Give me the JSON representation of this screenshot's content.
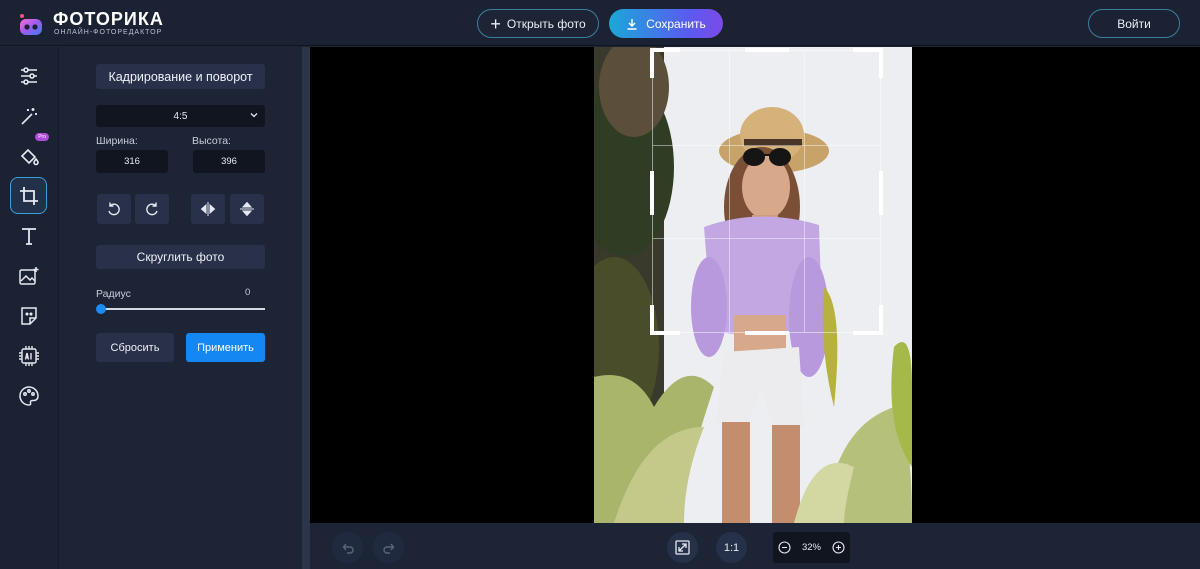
{
  "brand": {
    "title": "ФОТОРИКА",
    "subtitle": "ОНЛАЙН-ФОТОРЕДАКТОР",
    "accent_color": "#7c4ae8"
  },
  "header": {
    "open_label": "Открыть фото",
    "save_label": "Сохранить",
    "login_label": "Войти"
  },
  "rail": {
    "items": [
      {
        "icon": "sliders-icon",
        "active": false
      },
      {
        "icon": "magic-wand-icon",
        "active": false
      },
      {
        "icon": "paint-bucket-icon",
        "active": false,
        "badge": "Pro"
      },
      {
        "icon": "crop-icon",
        "active": true
      },
      {
        "icon": "text-icon",
        "active": false
      },
      {
        "icon": "add-image-icon",
        "active": false
      },
      {
        "icon": "sticker-icon",
        "active": false
      },
      {
        "icon": "ai-chip-icon",
        "active": false
      },
      {
        "icon": "palette-icon",
        "active": false
      }
    ]
  },
  "panel": {
    "title": "Кадрирование и поворот",
    "aspect_ratio": "4:5",
    "width_label": "Ширина:",
    "width_value": "316",
    "height_label": "Высота:",
    "height_value": "396",
    "tools": [
      "rotate-left-icon",
      "rotate-right-icon",
      "flip-horizontal-icon",
      "flip-vertical-icon"
    ],
    "round_label": "Скруглить фото",
    "radius_label": "Радиус",
    "radius_value": "0",
    "reset_label": "Сбросить",
    "apply_label": "Применить"
  },
  "bottom": {
    "fit_icon": "fit-screen-icon",
    "one_to_one": "1:1",
    "zoom": "32%"
  }
}
